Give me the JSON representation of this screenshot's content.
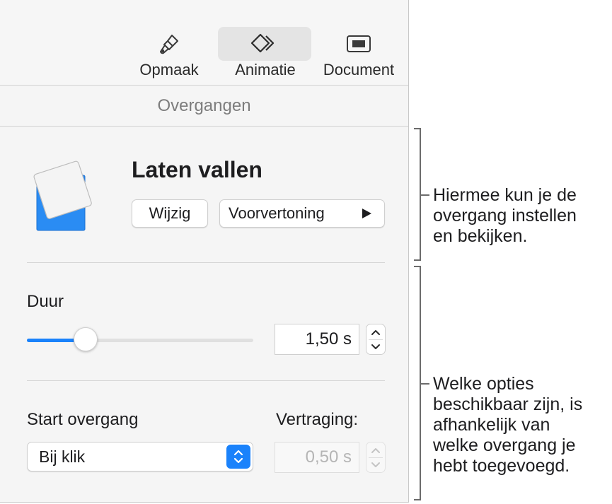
{
  "toolbar": {
    "tabs": [
      {
        "label": "Opmaak",
        "icon": "paintbrush-icon",
        "active": false
      },
      {
        "label": "Animatie",
        "icon": "diamond-icon",
        "active": true
      },
      {
        "label": "Document",
        "icon": "document-icon",
        "active": false
      }
    ]
  },
  "section": {
    "title": "Overgangen"
  },
  "effect": {
    "title": "Laten vallen",
    "edit_label": "Wijzig",
    "preview_label": "Voorvertoning"
  },
  "duration": {
    "label": "Duur",
    "value": "1,50 s",
    "slider_fraction": 0.26
  },
  "start": {
    "label": "Start overgang",
    "selected": "Bij klik"
  },
  "delay": {
    "label": "Vertraging:",
    "value": "0,50 s"
  },
  "callouts": {
    "top": [
      "Hiermee kun je de",
      "overgang instellen",
      "en bekijken."
    ],
    "bottom": [
      "Welke opties",
      "beschikbaar zijn, is",
      "afhankelijk van",
      "welke overgang je",
      "hebt toegevoegd."
    ]
  },
  "colors": {
    "accent": "#1a82fb",
    "thumb_blue": "#2a8cf3"
  }
}
